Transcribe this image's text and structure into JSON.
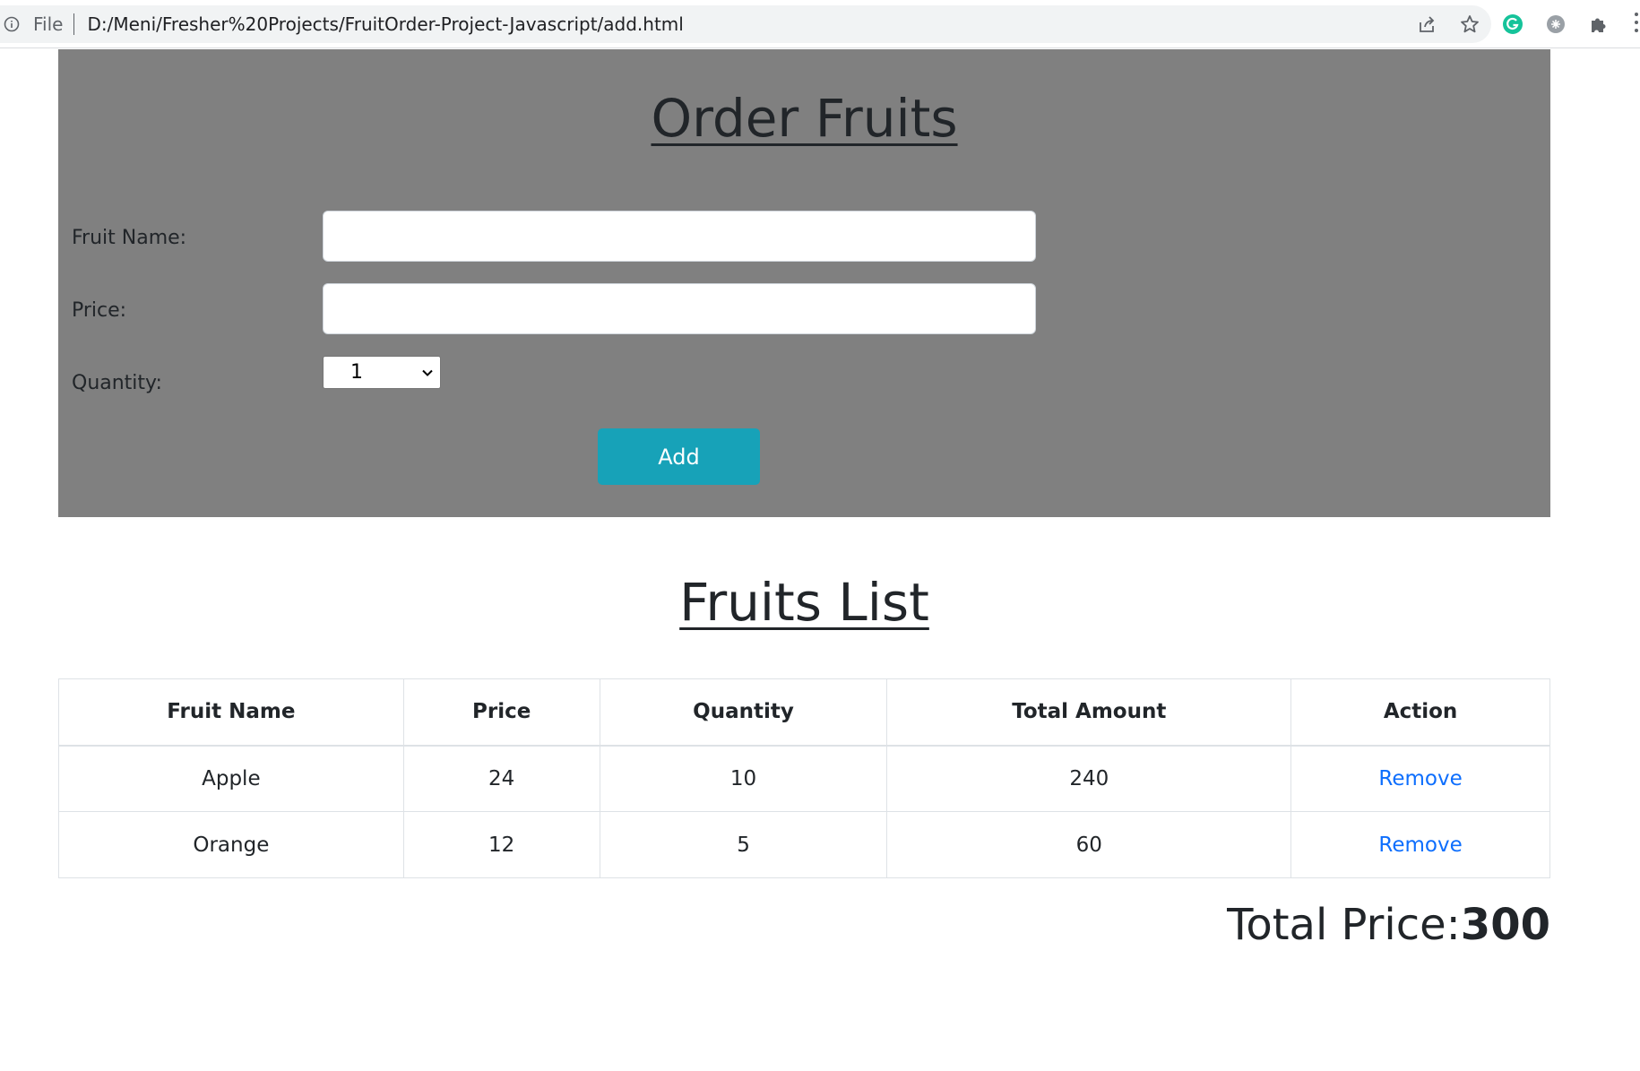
{
  "browser": {
    "scheme": "File",
    "url": "D:/Meni/Fresher%20Projects/FruitOrder-Project-Javascript/add.html",
    "icons": [
      "info-icon",
      "share-icon",
      "star-icon",
      "grammarly-icon",
      "extension-icon",
      "puzzle-icon",
      "menu-icon"
    ]
  },
  "order": {
    "title": "Order Fruits",
    "fruit_name_label": "Fruit Name:",
    "fruit_name_value": "",
    "price_label": "Price:",
    "price_value": "",
    "quantity_label": "Quantity:",
    "quantity_selected": "1",
    "add_label": "Add"
  },
  "list": {
    "title": "Fruits List",
    "headers": [
      "Fruit Name",
      "Price",
      "Quantity",
      "Total Amount",
      "Action"
    ],
    "rows": [
      {
        "name": "Apple",
        "price": "24",
        "quantity": "10",
        "total": "240",
        "action": "Remove"
      },
      {
        "name": "Orange",
        "price": "12",
        "quantity": "5",
        "total": "60",
        "action": "Remove"
      }
    ]
  },
  "total": {
    "label": "Total Price:",
    "value": "300"
  },
  "colors": {
    "panel_bg": "#808080",
    "add_button": "#17a2b8",
    "link": "#0d6efd",
    "grammarly": "#15c39a"
  }
}
